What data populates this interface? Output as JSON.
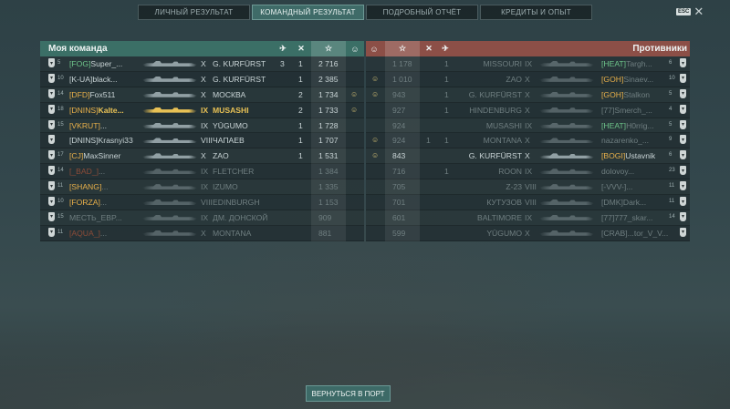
{
  "tabs": [
    {
      "label": "ЛИЧНЫЙ РЕЗУЛЬТАТ",
      "active": false
    },
    {
      "label": "КОМАНДНЫЙ РЕЗУЛЬТАТ",
      "active": true
    },
    {
      "label": "ПОДРОБНЫЙ ОТЧЁТ",
      "active": false
    },
    {
      "label": "КРЕДИТЫ И ОПЫТ",
      "active": false
    }
  ],
  "esc_label": "ESC",
  "my_team": {
    "title": "Моя команда",
    "rows": [
      {
        "level": "5",
        "tag": "[FOG]",
        "name": "Super_...",
        "tier": "X",
        "ship": "G. KURFÜRST",
        "planes": "3",
        "frags": "1",
        "xp": "2 716",
        "medal": false,
        "style": "",
        "tagc": "grn"
      },
      {
        "level": "10",
        "tag": "[K-UA]",
        "name": "black...",
        "tier": "X",
        "ship": "G. KURFÜRST",
        "planes": "",
        "frags": "1",
        "xp": "2 385",
        "medal": false,
        "style": "",
        "tagc": "dimtag"
      },
      {
        "level": "14",
        "tag": "[DFD]",
        "name": "Fox511",
        "tier": "X",
        "ship": "МОСКВА",
        "planes": "",
        "frags": "2",
        "xp": "1 734",
        "medal": true,
        "style": "",
        "tagc": ""
      },
      {
        "level": "18",
        "tag": "[DNINS]",
        "name": "Kalte...",
        "tier": "IX",
        "ship": "MUSASHI",
        "planes": "",
        "frags": "2",
        "xp": "1 733",
        "medal": true,
        "style": "gold",
        "tagc": ""
      },
      {
        "level": "15",
        "tag": "[VKRUT]",
        "name": "...",
        "tier": "IX",
        "ship": "YŪGUMO",
        "planes": "",
        "frags": "1",
        "xp": "1 728",
        "medal": false,
        "style": "",
        "tagc": ""
      },
      {
        "level": "",
        "tag": "[DNINS]",
        "name": "Krasnyi33",
        "tier": "VIII",
        "ship": "ЧАПАЕВ",
        "planes": "",
        "frags": "1",
        "xp": "1 707",
        "medal": false,
        "style": "",
        "tagc": "plain"
      },
      {
        "level": "17",
        "tag": "[CJ]",
        "name": "MaxSinner",
        "tier": "X",
        "ship": "ZAO",
        "planes": "",
        "frags": "1",
        "xp": "1 531",
        "medal": false,
        "style": "",
        "tagc": ""
      },
      {
        "level": "14",
        "tag": "[_BAD_]",
        "name": "...",
        "tier": "IX",
        "ship": "FLETCHER",
        "planes": "",
        "frags": "",
        "xp": "1 384",
        "medal": false,
        "style": "dim",
        "tagc": "red"
      },
      {
        "level": "11",
        "tag": "[SHANG]",
        "name": "...",
        "tier": "IX",
        "ship": "IZUMO",
        "planes": "",
        "frags": "",
        "xp": "1 335",
        "medal": false,
        "style": "dim",
        "tagc": ""
      },
      {
        "level": "10",
        "tag": "[FORZA]",
        "name": "...",
        "tier": "VIII",
        "ship": "EDINBURGH",
        "planes": "",
        "frags": "",
        "xp": "1 153",
        "medal": false,
        "style": "dim",
        "tagc": ""
      },
      {
        "level": "15",
        "tag": "",
        "name": "МЕСТЬ_EBP...",
        "tier": "IX",
        "ship": "ДМ. ДОНСКОЙ",
        "planes": "",
        "frags": "",
        "xp": "909",
        "medal": false,
        "style": "dim",
        "tagc": ""
      },
      {
        "level": "11",
        "tag": "[AQUA_]",
        "name": "...",
        "tier": "X",
        "ship": "MONTANA",
        "planes": "",
        "frags": "",
        "xp": "881",
        "medal": false,
        "style": "dim",
        "tagc": "red"
      }
    ]
  },
  "enemies": {
    "title": "Противники",
    "rows": [
      {
        "medal": false,
        "xp": "1 178",
        "planes": "",
        "frags": "1",
        "ship": "MISSOURI",
        "tier": "IX",
        "tag": "[HEAT]",
        "name": "Targh...",
        "level": "6",
        "style": "dim",
        "tagc": "grn"
      },
      {
        "medal": true,
        "xp": "1 010",
        "planes": "",
        "frags": "1",
        "ship": "ZAO",
        "tier": "X",
        "tag": "[GOH]",
        "name": "Sinaev...",
        "level": "10",
        "style": "dim",
        "tagc": ""
      },
      {
        "medal": true,
        "xp": "943",
        "planes": "",
        "frags": "1",
        "ship": "G. KURFÜRST",
        "tier": "X",
        "tag": "[GOH]",
        "name": "Stalkon",
        "level": "5",
        "style": "dim",
        "tagc": ""
      },
      {
        "medal": false,
        "xp": "927",
        "planes": "",
        "frags": "1",
        "ship": "HINDENBURG",
        "tier": "X",
        "tag": "[77]",
        "name": "Smerch_...",
        "level": "4",
        "style": "dim",
        "tagc": "dimtag"
      },
      {
        "medal": false,
        "xp": "924",
        "planes": "",
        "frags": "",
        "ship": "MUSASHI",
        "tier": "IX",
        "tag": "[HEAT]",
        "name": "H0rrig...",
        "level": "5",
        "style": "dim",
        "tagc": "grn"
      },
      {
        "medal": true,
        "xp": "924",
        "planes": "1",
        "frags": "1",
        "ship": "MONTANA",
        "tier": "X",
        "tag": "",
        "name": "nazarenko_...",
        "level": "9",
        "style": "dim",
        "tagc": ""
      },
      {
        "medal": true,
        "xp": "843",
        "planes": "",
        "frags": "",
        "ship": "G. KURFÜRST",
        "tier": "X",
        "tag": "[BOGI]",
        "name": "Ustavnik",
        "level": "6",
        "style": "",
        "tagc": ""
      },
      {
        "medal": false,
        "xp": "716",
        "planes": "",
        "frags": "1",
        "ship": "ROON",
        "tier": "IX",
        "tag": "",
        "name": "dolovoy...",
        "level": "23",
        "style": "dim",
        "tagc": ""
      },
      {
        "medal": false,
        "xp": "705",
        "planes": "",
        "frags": "",
        "ship": "Z-23",
        "tier": "VIII",
        "tag": "[-VVV-]",
        "name": "...",
        "level": "11",
        "style": "dim",
        "tagc": "plain"
      },
      {
        "medal": false,
        "xp": "701",
        "planes": "",
        "frags": "",
        "ship": "КУТУЗОВ",
        "tier": "VIII",
        "tag": "[DMK]",
        "name": "Dark...",
        "level": "11",
        "style": "dim",
        "tagc": "plain"
      },
      {
        "medal": false,
        "xp": "601",
        "planes": "",
        "frags": "",
        "ship": "BALTIMORE",
        "tier": "IX",
        "tag": "[77]",
        "name": "777_skar...",
        "level": "14",
        "style": "dim",
        "tagc": "dimtag"
      },
      {
        "medal": false,
        "xp": "599",
        "planes": "",
        "frags": "",
        "ship": "YŪGUMO",
        "tier": "X",
        "tag": "[CRAB]",
        "name": "...tor_V_V...",
        "level": "",
        "style": "dim",
        "tagc": "plain"
      }
    ]
  },
  "back_button": "ВЕРНУТЬСЯ В ПОРТ",
  "colors": {
    "ally_header": "#3b6f66",
    "enemy_header": "#8c4f47",
    "gold": "#e8c155"
  }
}
